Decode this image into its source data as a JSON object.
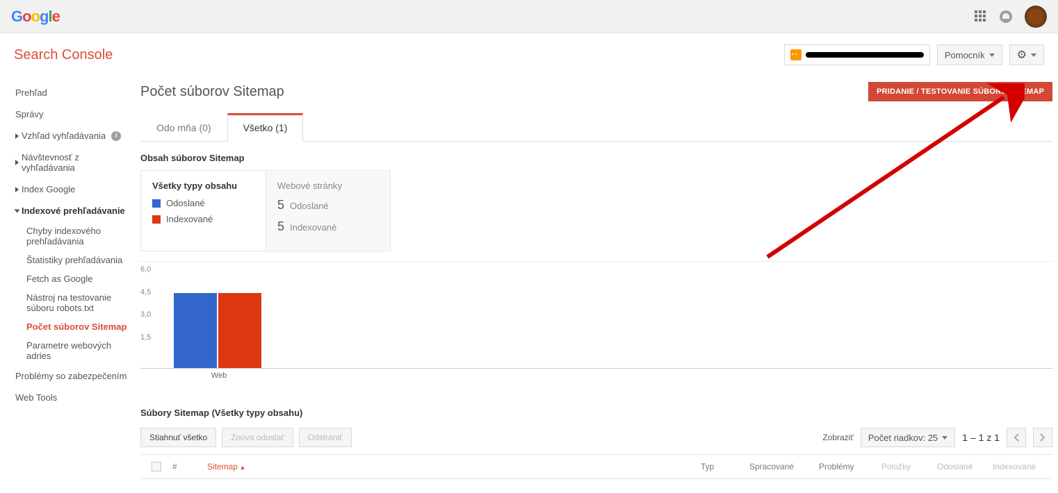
{
  "product": "Search Console",
  "header": {
    "help_label": "Pomocník"
  },
  "sidebar": {
    "overview": "Prehľad",
    "messages": "Správy",
    "search_appearance": "Vzhľad vyhľadávania",
    "search_traffic": "Návštevnosť z vyhľadávania",
    "google_index": "Index Google",
    "crawl": "Indexové prehľadávanie",
    "crawl_errors": "Chyby indexového prehľadávania",
    "crawl_stats": "Štatistiky prehľadávania",
    "fetch_as_google": "Fetch as Google",
    "robots_tester": "Nástroj na testovanie súboru robots.txt",
    "sitemaps": "Počet súborov Sitemap",
    "url_params": "Parametre webových adries",
    "security": "Problémy so zabezpečením",
    "web_tools": "Web Tools"
  },
  "page": {
    "title": "Počet súborov Sitemap",
    "add_test_button": "PRIDANIE / TESTOVANIE SÚBORU SITEMAP",
    "tabs": {
      "mine": "Odo mňa (0)",
      "all": "Všetko (1)"
    },
    "content_section_title": "Obsah súborov Sitemap",
    "legend": {
      "title": "Všetky typy obsahu",
      "sent": "Odoslané",
      "indexed": "Indexované"
    },
    "stats": {
      "title": "Webové stránky",
      "sent_value": "5",
      "sent_label": "Odoslané",
      "indexed_value": "5",
      "indexed_label": "Indexované"
    },
    "files_section_title": "Súbory Sitemap (Všetky typy obsahu)",
    "buttons": {
      "download_all": "Stiahnuť všetko",
      "resubmit": "Znova odoslať",
      "delete": "Odstrániť"
    },
    "pager": {
      "show_label": "Zobraziť",
      "rows_label": "Počet riadkov: 25",
      "range": "1 – 1 z 1"
    },
    "table": {
      "col_num": "#",
      "col_sitemap": "Sitemap",
      "col_type": "Typ",
      "col_processed": "Spracované",
      "col_problems": "Problémy",
      "col_items": "Položky",
      "col_sent": "Odoslané",
      "col_indexed": "Indexované"
    }
  },
  "chart_data": {
    "type": "bar",
    "categories": [
      "Web"
    ],
    "series": [
      {
        "name": "Odoslané",
        "color": "#3366cc",
        "values": [
          5
        ]
      },
      {
        "name": "Indexované",
        "color": "#dc3912",
        "values": [
          5
        ]
      }
    ],
    "ylim": [
      0,
      6
    ],
    "yticks": [
      1.5,
      3.0,
      4.5,
      6.0
    ],
    "xlabel": "Web"
  }
}
